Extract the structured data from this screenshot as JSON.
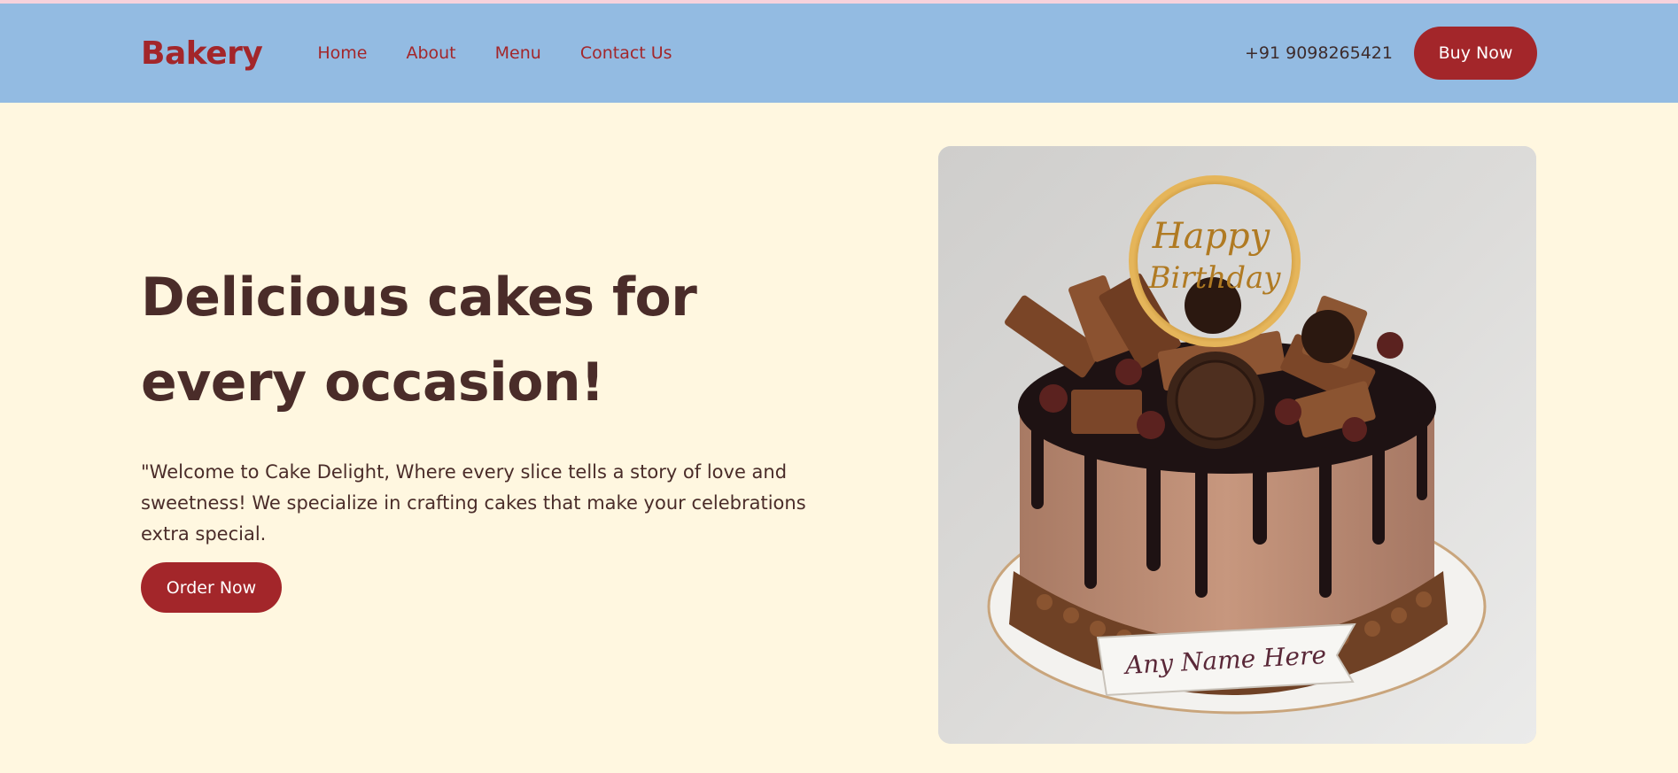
{
  "nav": {
    "logo": "Bakery",
    "links": [
      {
        "label": "Home"
      },
      {
        "label": "About"
      },
      {
        "label": "Menu"
      },
      {
        "label": "Contact Us"
      }
    ],
    "phone": "+91 9098265421",
    "buy_label": "Buy Now"
  },
  "hero": {
    "title_line1": "Delicious cakes for",
    "title_line2": "every occasion!",
    "description": "\"Welcome to Cake Delight, Where every slice tells a story of love and sweetness! We specialize in crafting cakes that make your celebrations extra special.",
    "order_label": "Order Now",
    "image": {
      "topper_text_1": "Happy",
      "topper_text_2": "Birthday",
      "plaque_text": "Any Name Here"
    }
  },
  "colors": {
    "brand_red": "#a3262a",
    "nav_bg": "#93bbe2",
    "page_bg": "#fff7e0",
    "heading_brown": "#4a2c29"
  }
}
